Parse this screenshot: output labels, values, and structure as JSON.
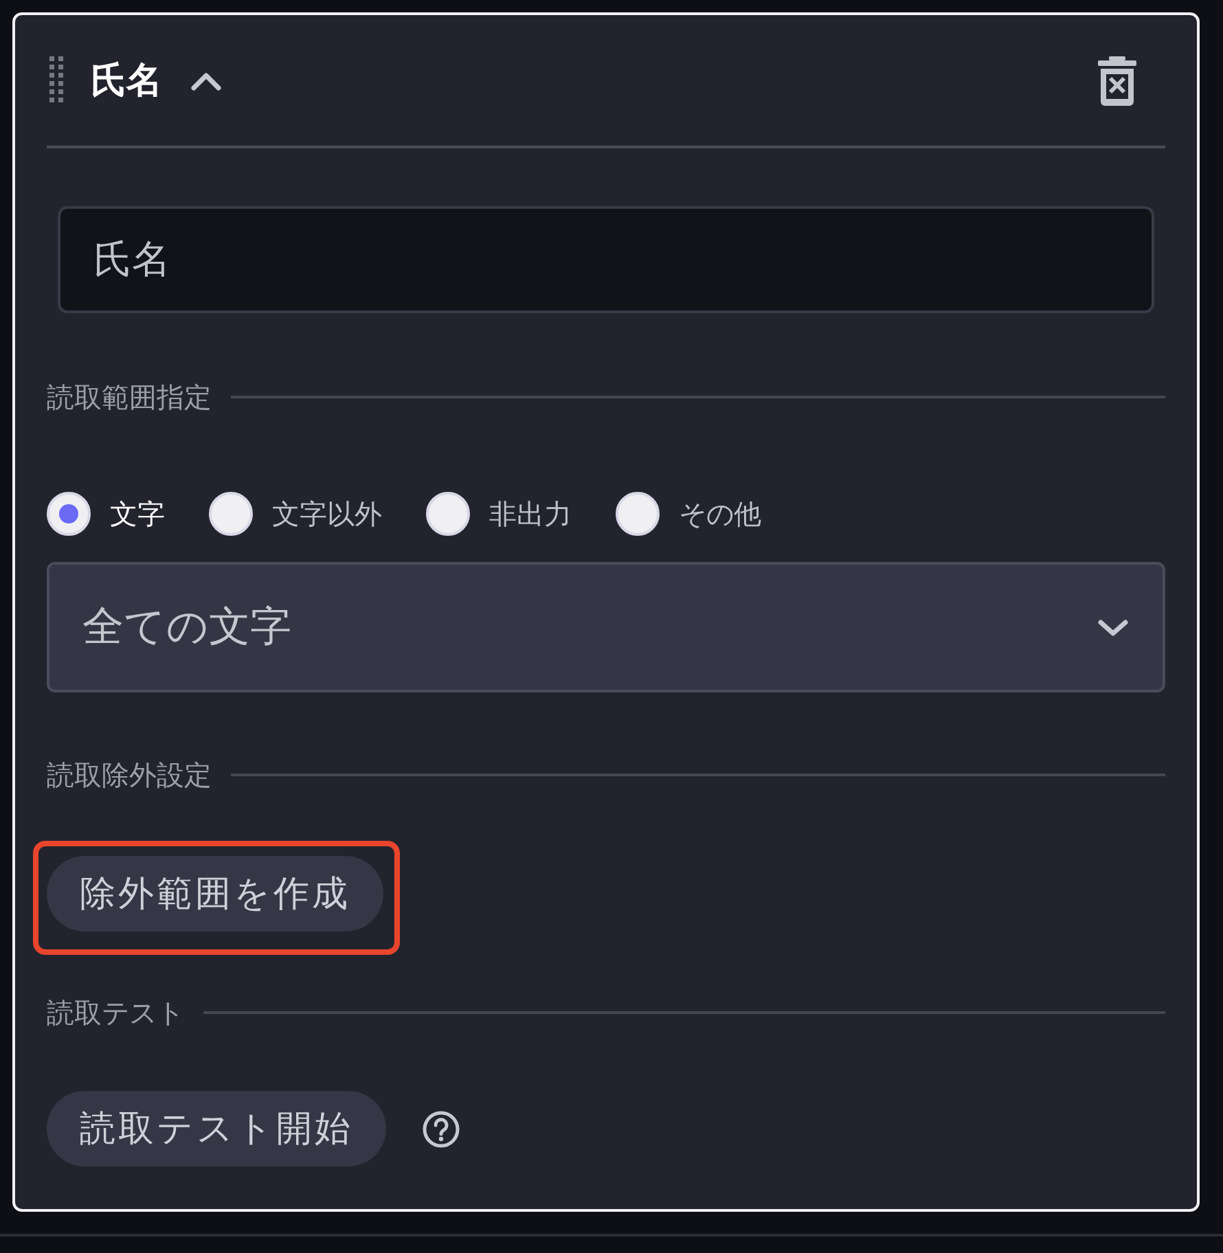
{
  "header": {
    "title": "氏名",
    "expanded": true
  },
  "name_field": {
    "value": "氏名"
  },
  "read_range": {
    "label": "読取範囲指定",
    "options": [
      {
        "label": "文字",
        "selected": true
      },
      {
        "label": "文字以外",
        "selected": false
      },
      {
        "label": "非出力",
        "selected": false
      },
      {
        "label": "その他",
        "selected": false
      }
    ],
    "dropdown": {
      "value": "全ての文字"
    }
  },
  "exclusion": {
    "label": "読取除外設定",
    "button": {
      "label": "除外範囲を作成",
      "highlighted": true
    }
  },
  "read_test": {
    "label": "読取テスト",
    "button": {
      "label": "読取テスト開始"
    }
  }
}
